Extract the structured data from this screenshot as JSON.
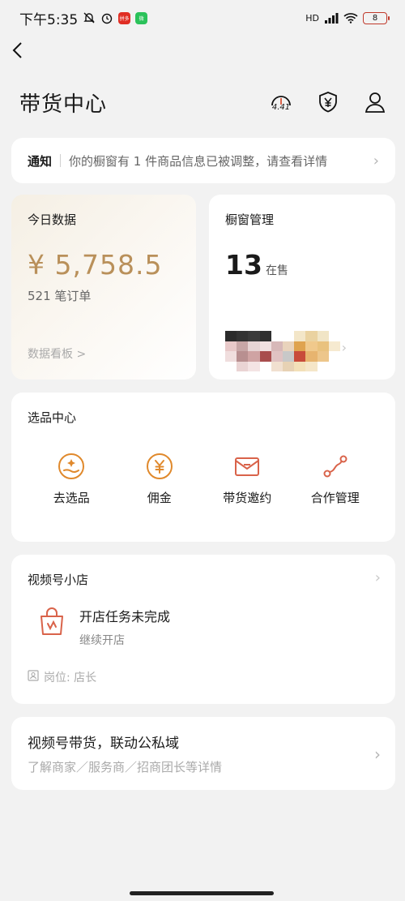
{
  "status_bar": {
    "time": "下午5:35",
    "app_badge_1": "拼多",
    "app_badge_2": "微",
    "network": "HD",
    "battery": "8"
  },
  "header": {
    "title": "带货中心",
    "score": "4.41"
  },
  "notice": {
    "label": "通知",
    "text": "你的橱窗有 1 件商品信息已被调整，请查看详情"
  },
  "today_data": {
    "title": "今日数据",
    "amount": "¥ 5,758.5",
    "orders": "521 笔订单",
    "link": "数据看板 >"
  },
  "showcase": {
    "title": "橱窗管理",
    "count": "13",
    "count_unit": "在售"
  },
  "select_center": {
    "title": "选品中心",
    "items": [
      {
        "label": "去选品",
        "icon": "hand-sparkle-icon"
      },
      {
        "label": "佣金",
        "icon": "yen-coin-icon"
      },
      {
        "label": "带货邀约",
        "icon": "envelope-icon"
      },
      {
        "label": "合作管理",
        "icon": "connection-path-icon"
      }
    ]
  },
  "shop": {
    "title": "视频号小店",
    "task_title": "开店任务未完成",
    "task_sub": "继续开店",
    "role": "岗位: 店长"
  },
  "promo": {
    "title": "视频号带货，联动公私域",
    "sub": "了解商家／服务商／招商团长等详情"
  },
  "colors": {
    "accent_gold": "#b9905a",
    "icon_orange": "#e0892c",
    "icon_red": "#d9634a"
  }
}
